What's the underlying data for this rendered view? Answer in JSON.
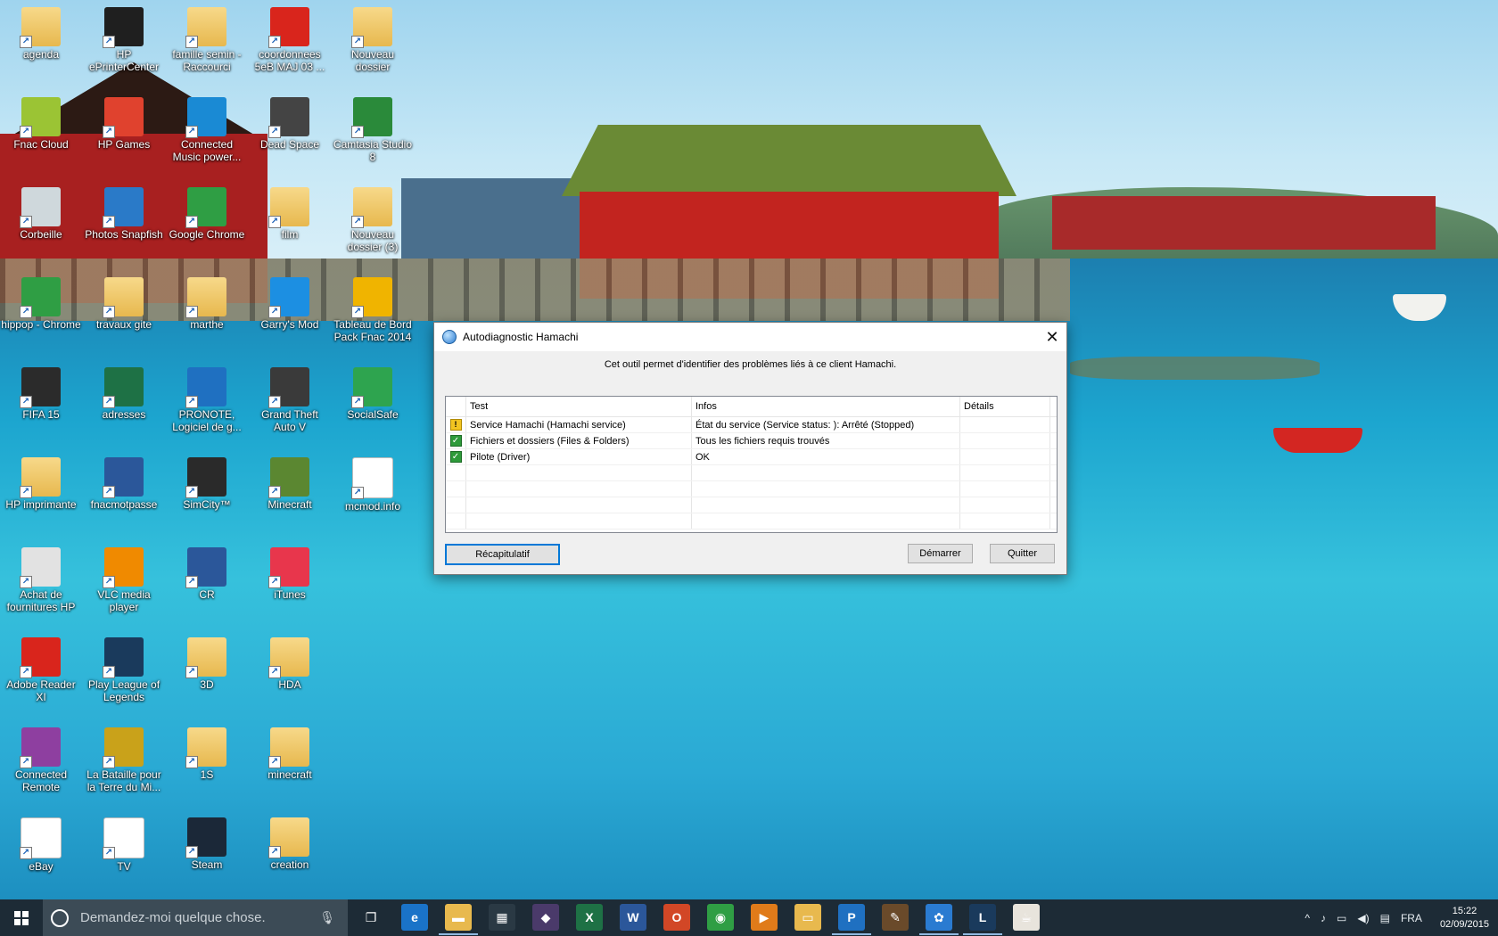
{
  "desktop_icons": [
    {
      "label": "agenda",
      "icon": "folder-icon",
      "color": "#e8b94e"
    },
    {
      "label": "HP ePrinterCenter",
      "icon": "printer-icon",
      "color": "#1f1f1f"
    },
    {
      "label": "famille semin - Raccourci",
      "icon": "folder-user-icon",
      "color": "#e8b94e"
    },
    {
      "label": "coordonnees 5eB MAJ 03 ...",
      "icon": "pdf-icon",
      "color": "#d9251c"
    },
    {
      "label": "Nouveau dossier",
      "icon": "folder-icon",
      "color": "#e8b94e"
    },
    {
      "label": "Fnac Cloud",
      "icon": "cloud-icon",
      "color": "#9bc434"
    },
    {
      "label": "HP Games",
      "icon": "games-icon",
      "color": "#e0422e"
    },
    {
      "label": "Connected Music power...",
      "icon": "equalizer-icon",
      "color": "#1a8ad4"
    },
    {
      "label": "Dead Space",
      "icon": "deadspace-icon",
      "color": "#444444"
    },
    {
      "label": "Camtasia Studio 8",
      "icon": "camtasia-icon",
      "color": "#2a8a3a"
    },
    {
      "label": "Corbeille",
      "icon": "recycle-bin-icon",
      "color": "#cfd8dc"
    },
    {
      "label": "Photos Snapfish",
      "icon": "snapfish-icon",
      "color": "#2a7ac8"
    },
    {
      "label": "Google Chrome",
      "icon": "chrome-icon",
      "color": "#2f9e44"
    },
    {
      "label": "film",
      "icon": "folder-icon",
      "color": "#e8b94e"
    },
    {
      "label": "Nouveau dossier (3)",
      "icon": "folder-icon",
      "color": "#e8b94e"
    },
    {
      "label": "hippop - Chrome",
      "icon": "chrome-icon",
      "color": "#2f9e44"
    },
    {
      "label": "travaux gite",
      "icon": "folder-icon",
      "color": "#e8b94e"
    },
    {
      "label": "marthe",
      "icon": "folder-icon",
      "color": "#e8b94e"
    },
    {
      "label": "Garry's Mod",
      "icon": "gmod-icon",
      "color": "#1c8fe2"
    },
    {
      "label": "Tableau de Bord Pack Fnac 2014",
      "icon": "fnac-icon",
      "color": "#f0b400"
    },
    {
      "label": "FIFA 15",
      "icon": "fifa-icon",
      "color": "#2b2b2b"
    },
    {
      "label": "adresses",
      "icon": "excel-icon",
      "color": "#1e7145"
    },
    {
      "label": "PRONOTE, Logiciel de g...",
      "icon": "pronote-icon",
      "color": "#1f70c1"
    },
    {
      "label": "Grand Theft Auto V",
      "icon": "gta-icon",
      "color": "#3a3a3a"
    },
    {
      "label": "SocialSafe",
      "icon": "socialsafe-icon",
      "color": "#2ea44f"
    },
    {
      "label": "HP imprimante",
      "icon": "folder-icon",
      "color": "#e8b94e"
    },
    {
      "label": "fnacmotpasse",
      "icon": "word-icon",
      "color": "#2b579a"
    },
    {
      "label": "SimCity™",
      "icon": "simcity-icon",
      "color": "#2a2a2a"
    },
    {
      "label": "Minecraft",
      "icon": "minecraft-icon",
      "color": "#5b8731"
    },
    {
      "label": "mcmod.info",
      "icon": "file-icon",
      "color": "#ffffff"
    },
    {
      "label": "Achat de fournitures HP",
      "icon": "printer-icon",
      "color": "#e2e2e2"
    },
    {
      "label": "VLC media player",
      "icon": "vlc-icon",
      "color": "#f08a00"
    },
    {
      "label": "CR",
      "icon": "word-icon",
      "color": "#2b579a"
    },
    {
      "label": "iTunes",
      "icon": "itunes-icon",
      "color": "#e8364c"
    },
    {
      "label": "Adobe Reader XI",
      "icon": "pdf-icon",
      "color": "#d9251c"
    },
    {
      "label": "Play League of Legends",
      "icon": "lol-icon",
      "color": "#1a3a5c"
    },
    {
      "label": "3D",
      "icon": "folder-icon",
      "color": "#e8b94e"
    },
    {
      "label": "HDA",
      "icon": "folder-icon",
      "color": "#e8b94e"
    },
    {
      "label": "Connected Remote",
      "icon": "remote-icon",
      "color": "#8e3fa0"
    },
    {
      "label": "La Bataille pour la Terre du Mi...",
      "icon": "ring-icon",
      "color": "#c9a21a"
    },
    {
      "label": "1S",
      "icon": "folder-icon",
      "color": "#e8b94e"
    },
    {
      "label": "minecraft",
      "icon": "folder-icon",
      "color": "#e8b94e"
    },
    {
      "label": "eBay",
      "icon": "ebay-icon",
      "color": "#ffffff"
    },
    {
      "label": "TV",
      "icon": "tv-icon",
      "color": "#ffffff"
    },
    {
      "label": "Steam",
      "icon": "steam-icon",
      "color": "#1b2838"
    },
    {
      "label": "creation",
      "icon": "folder-icon",
      "color": "#e8b94e"
    }
  ],
  "dialog": {
    "title": "Autodiagnostic Hamachi",
    "description": "Cet outil permet d'identifier des problèmes liés à ce client Hamachi.",
    "columns": [
      "Test",
      "Infos",
      "Détails"
    ],
    "rows": [
      {
        "status": "warning",
        "status_glyph": "!",
        "test": "Service Hamachi (Hamachi service)",
        "infos": "État du service (Service status: ): Arrêté (Stopped)",
        "details": ""
      },
      {
        "status": "ok",
        "status_glyph": "✓",
        "test": "Fichiers et dossiers (Files & Folders)",
        "infos": "Tous les fichiers requis trouvés",
        "details": ""
      },
      {
        "status": "ok",
        "status_glyph": "✓",
        "test": "Pilote (Driver)",
        "infos": "OK",
        "details": ""
      }
    ],
    "buttons": {
      "summary": "Récapitulatif",
      "start": "Démarrer",
      "quit": "Quitter"
    },
    "close_glyph": "✕"
  },
  "taskbar": {
    "search_placeholder": "Demandez-moi quelque chose.",
    "apps": [
      {
        "name": "task-view-icon",
        "color": "#1d2b36",
        "glyph": "❐"
      },
      {
        "name": "edge-icon",
        "color": "#1a73c8",
        "glyph": "e"
      },
      {
        "name": "file-explorer-icon",
        "color": "#e8b94e",
        "glyph": "▬"
      },
      {
        "name": "store-icon",
        "color": "#2a3944",
        "glyph": "▦"
      },
      {
        "name": "photo-app-icon",
        "color": "#4a3a6a",
        "glyph": "◆"
      },
      {
        "name": "excel-icon",
        "color": "#1e7145",
        "glyph": "X"
      },
      {
        "name": "word-icon",
        "color": "#2b579a",
        "glyph": "W"
      },
      {
        "name": "office-icon",
        "color": "#d24726",
        "glyph": "O"
      },
      {
        "name": "chrome-icon",
        "color": "#2f9e44",
        "glyph": "◉"
      },
      {
        "name": "media-player-icon",
        "color": "#e07b1a",
        "glyph": "▶"
      },
      {
        "name": "folder-app-icon",
        "color": "#e8b94e",
        "glyph": "▭"
      },
      {
        "name": "pronote-icon",
        "color": "#1f70c1",
        "glyph": "P"
      },
      {
        "name": "tool-icon",
        "color": "#6a4a2a",
        "glyph": "✎"
      },
      {
        "name": "hamachi-icon",
        "color": "#2a7bd1",
        "glyph": "✿"
      },
      {
        "name": "league-icon",
        "color": "#1a3a5c",
        "glyph": "L"
      },
      {
        "name": "java-icon",
        "color": "#e8e4dc",
        "glyph": "☕"
      }
    ],
    "tray": {
      "chevron": "^",
      "language": "FRA",
      "time": "15:22",
      "date": "02/09/2015"
    }
  }
}
